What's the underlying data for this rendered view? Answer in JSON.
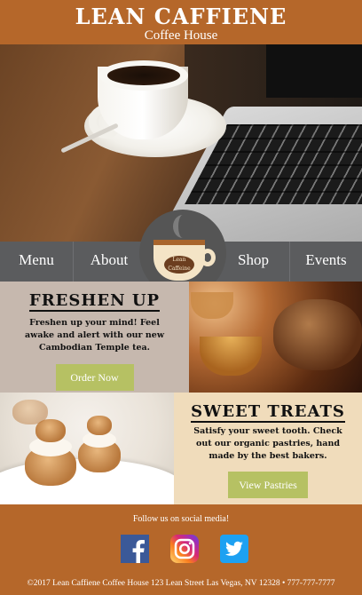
{
  "header": {
    "title": "LEAN CAFFIENE",
    "subtitle": "Coffee House"
  },
  "nav": {
    "items": [
      {
        "label": "Menu"
      },
      {
        "label": "About"
      },
      {
        "label": "Shop"
      },
      {
        "label": "Events"
      }
    ]
  },
  "logo": {
    "text": "Lean Caffeine"
  },
  "promo_tea": {
    "heading": "FRESHEN UP",
    "body": "Freshen up your mind! Feel awake and alert with our new Cambodian Temple tea.",
    "button_label": "Order Now"
  },
  "promo_pastries": {
    "heading": "SWEET TREATS",
    "body": "Satisfy your sweet tooth. Check out our organic pastries, hand made by the best bakers.",
    "button_label": "View Pastries"
  },
  "footer": {
    "follow_text": "Follow us on social media!",
    "social": [
      {
        "name": "facebook-icon",
        "color": "#3b5998"
      },
      {
        "name": "instagram-icon",
        "color": "#c13584"
      },
      {
        "name": "twitter-icon",
        "color": "#1da1f2"
      }
    ],
    "copyright": "©2017 Lean Caffiene Coffee House     123 Lean Street Las Vegas, NV 12328 • 777-777-7777"
  },
  "colors": {
    "brand_brown": "#b5672a",
    "nav_gray": "#5b5c5e",
    "button_green": "#b6c163",
    "panel_gray": "#c6b8ae",
    "panel_cream": "#f0dcbb"
  }
}
